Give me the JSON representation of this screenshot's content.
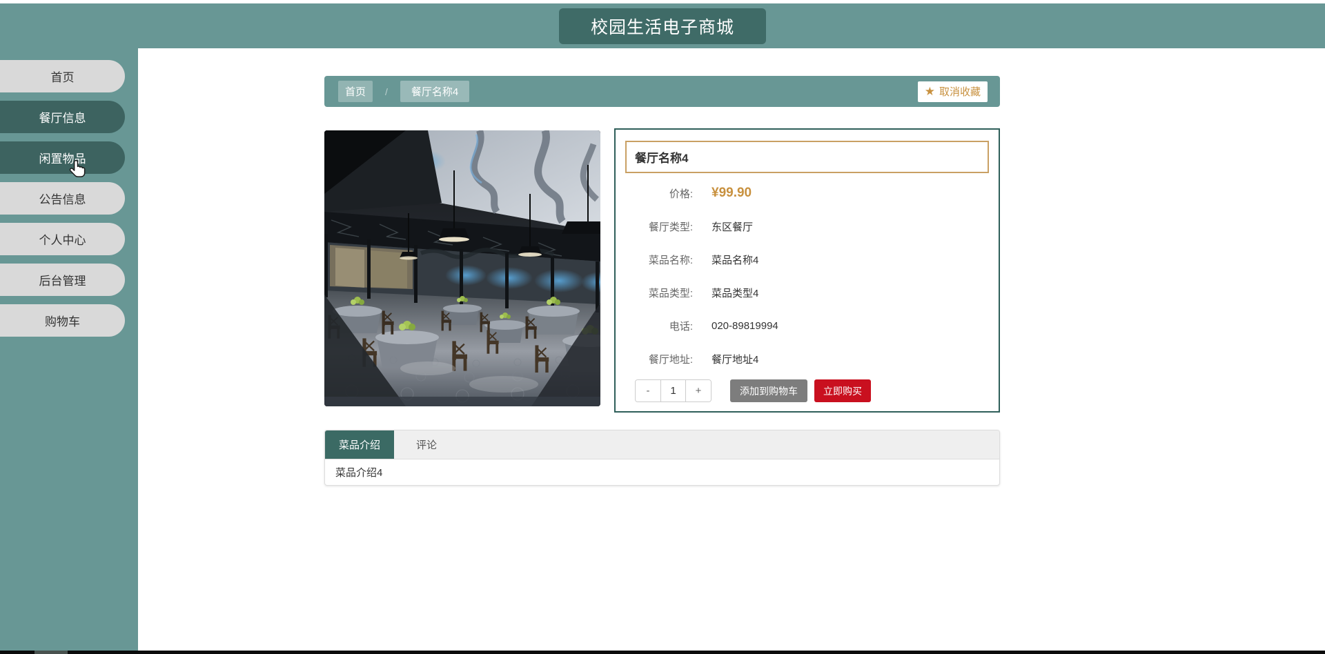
{
  "colors": {
    "teal": "#689795",
    "teal-dark": "#3d6360",
    "header-box": "#3f6b67",
    "panel-border": "#2e5e59",
    "gold": "#c8913f",
    "gold-border": "#c9a063",
    "red": "#c9101f",
    "gray-btn": "#7d7d7d",
    "pill": "#d9d9d9",
    "tab-active": "#3b6a64"
  },
  "header": {
    "title": "校园生活电子商城"
  },
  "sidebar": {
    "items": [
      {
        "key": "home",
        "label": "首页",
        "highlight": false
      },
      {
        "key": "restaurant-info",
        "label": "餐厅信息",
        "highlight": true
      },
      {
        "key": "idle-items",
        "label": "闲置物品",
        "highlight": true
      },
      {
        "key": "announcements",
        "label": "公告信息",
        "highlight": false
      },
      {
        "key": "personal-center",
        "label": "个人中心",
        "highlight": false
      },
      {
        "key": "admin",
        "label": "后台管理",
        "highlight": false
      },
      {
        "key": "cart",
        "label": "购物车",
        "highlight": false
      }
    ]
  },
  "breadcrumb": {
    "separator": "/",
    "items": [
      "首页",
      "餐厅名称4"
    ]
  },
  "favorite": {
    "label": "取消收藏",
    "icon": "star-icon"
  },
  "product": {
    "title": "餐厅名称4",
    "fields": [
      {
        "label": "价格:",
        "value": "¥99.90",
        "type": "price"
      },
      {
        "label": "餐厅类型:",
        "value": "东区餐厅",
        "type": "text"
      },
      {
        "label": "菜品名称:",
        "value": "菜品名称4",
        "type": "text"
      },
      {
        "label": "菜品类型:",
        "value": "菜品类型4",
        "type": "text"
      },
      {
        "label": "电话:",
        "value": "020-89819994",
        "type": "text"
      },
      {
        "label": "餐厅地址:",
        "value": "餐厅地址4",
        "type": "text"
      }
    ],
    "quantity": {
      "minus": "-",
      "value": "1",
      "plus": "+"
    },
    "add_to_cart_label": "添加到购物车",
    "buy_now_label": "立即购买"
  },
  "tabs": {
    "items": [
      {
        "key": "dish-intro",
        "label": "菜品介绍",
        "active": true
      },
      {
        "key": "comments",
        "label": "评论",
        "active": false
      }
    ],
    "content": "菜品介绍4"
  }
}
